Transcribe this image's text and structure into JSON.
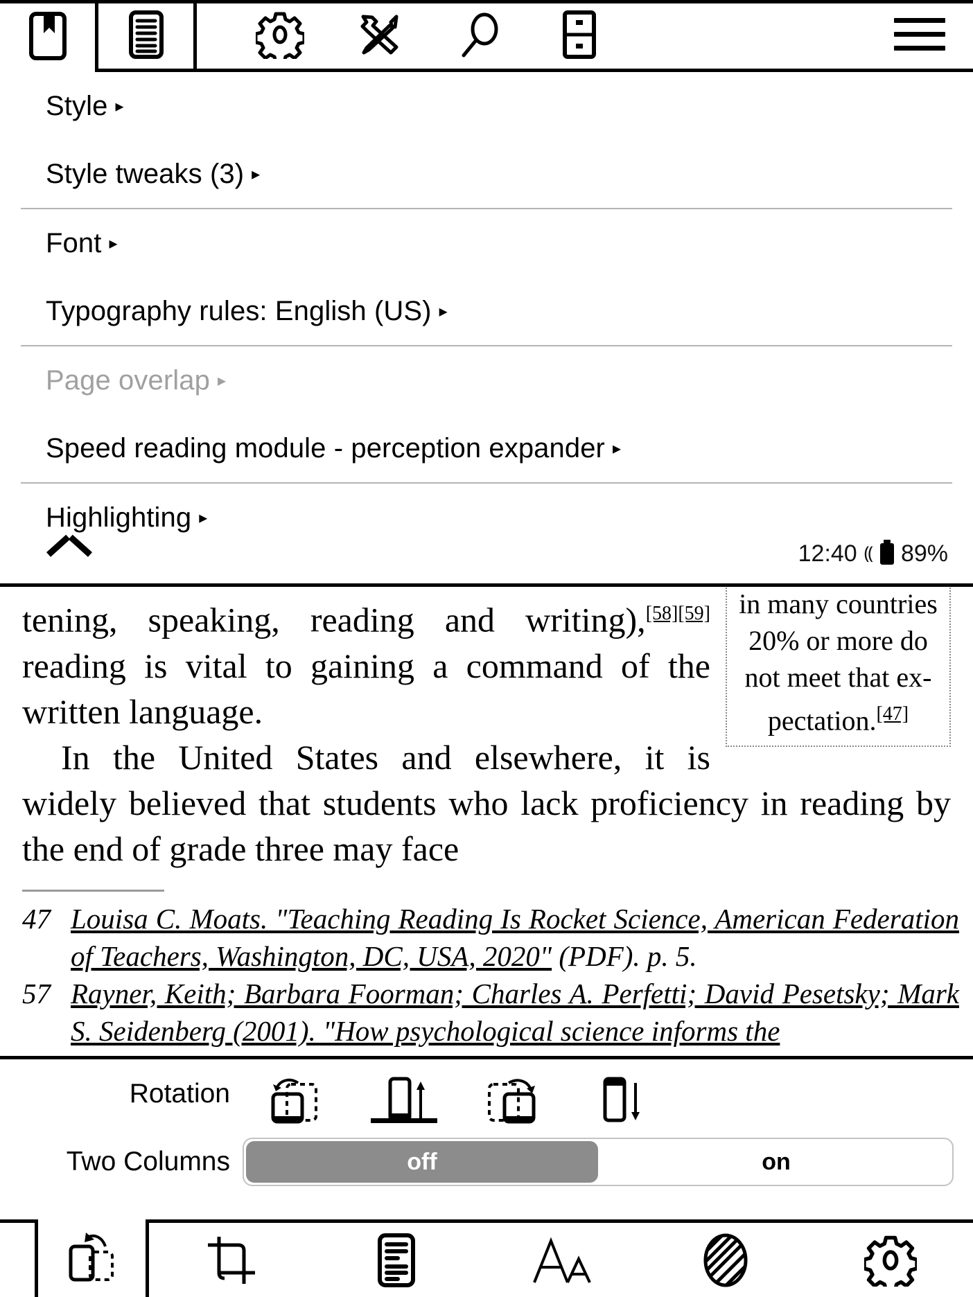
{
  "topbar": {
    "tabs": [
      {
        "id": "bookmark",
        "icon": "bookmark-page-icon",
        "selected": true
      },
      {
        "id": "document",
        "icon": "document-lines-icon",
        "selected": false
      }
    ],
    "tools": [
      {
        "id": "settings",
        "icon": "gear-icon"
      },
      {
        "id": "tools",
        "icon": "tools-icon"
      },
      {
        "id": "search",
        "icon": "magnifier-icon"
      },
      {
        "id": "pagelayout",
        "icon": "page-split-icon"
      }
    ],
    "menu_button": {
      "icon": "hamburger-menu-icon"
    }
  },
  "menu": {
    "items": [
      {
        "label": "Style",
        "caret": "▸",
        "disabled": false,
        "separator_after": false
      },
      {
        "label": "Style tweaks (3)",
        "caret": "▸",
        "disabled": false,
        "separator_after": true
      },
      {
        "label": "Font",
        "caret": "▸",
        "disabled": false,
        "separator_after": false
      },
      {
        "label": "Typography rules: English (US)",
        "caret": "▸",
        "disabled": false,
        "separator_after": true
      },
      {
        "label": "Page overlap",
        "caret": "▸",
        "disabled": true,
        "separator_after": false
      },
      {
        "label": "Speed reading module - perception expander",
        "caret": "▸",
        "disabled": false,
        "separator_after": true
      },
      {
        "label": "Highlighting",
        "caret": "▸",
        "disabled": false,
        "separator_after": false
      }
    ],
    "collapse": {
      "icon": "chevron-up-icon"
    }
  },
  "status": {
    "time": "12:40",
    "charging_icon": "⸨",
    "battery_icon": "battery-icon",
    "battery": "89%"
  },
  "content": {
    "paragraph_1_a": "tening, speaking, reading and writing),",
    "paragraph_1_ref1": "[58]",
    "paragraph_1_ref2": "[59]",
    "paragraph_1_b": " reading is vital to gaining a command of the written language.",
    "paragraph_2_a": "In the United States and elsewhere, it is widely believed that students who lack proficiency in reading by the end of grade three may face",
    "sidebox_text": "in many countries 20% or more do not meet that ex-pectation.",
    "sidebox_ref": "[47]"
  },
  "footnotes": [
    {
      "num": "47",
      "link_text": "Louisa C. Moats. \"Teaching Reading Is Rocket Science, American Federation of Teachers, Washington, DC, USA, 2020\"",
      "tail_text": " (PDF). p. 5."
    },
    {
      "num": "57",
      "link_text": "Rayner, Keith; Barbara Foorman; Charles A. Perfetti; David Pesetsky; Mark S. Seidenberg (2001). \"How psychological science informs the",
      "tail_text": ""
    }
  ],
  "settings": {
    "rotation": {
      "label": "Rotation",
      "options": [
        {
          "id": "rotate-ccw",
          "icon": "rotate-counterclockwise-icon",
          "selected": false
        },
        {
          "id": "portrait-up",
          "icon": "portrait-up-icon",
          "selected": true
        },
        {
          "id": "rotate-cw",
          "icon": "rotate-clockwise-icon",
          "selected": false
        },
        {
          "id": "portrait-down",
          "icon": "portrait-down-icon",
          "selected": false
        }
      ]
    },
    "two_columns": {
      "label": "Two Columns",
      "options": [
        {
          "value": "off",
          "selected": true
        },
        {
          "value": "on",
          "selected": false
        }
      ]
    }
  },
  "bottomnav": {
    "active": {
      "id": "rotation",
      "icon": "device-rotate-icon"
    },
    "items": [
      {
        "id": "crop",
        "icon": "crop-icon"
      },
      {
        "id": "page",
        "icon": "page-text-icon"
      },
      {
        "id": "font-size",
        "icon": "font-size-icon"
      },
      {
        "id": "contrast",
        "icon": "contrast-icon"
      },
      {
        "id": "settings",
        "icon": "gear-icon"
      }
    ]
  }
}
